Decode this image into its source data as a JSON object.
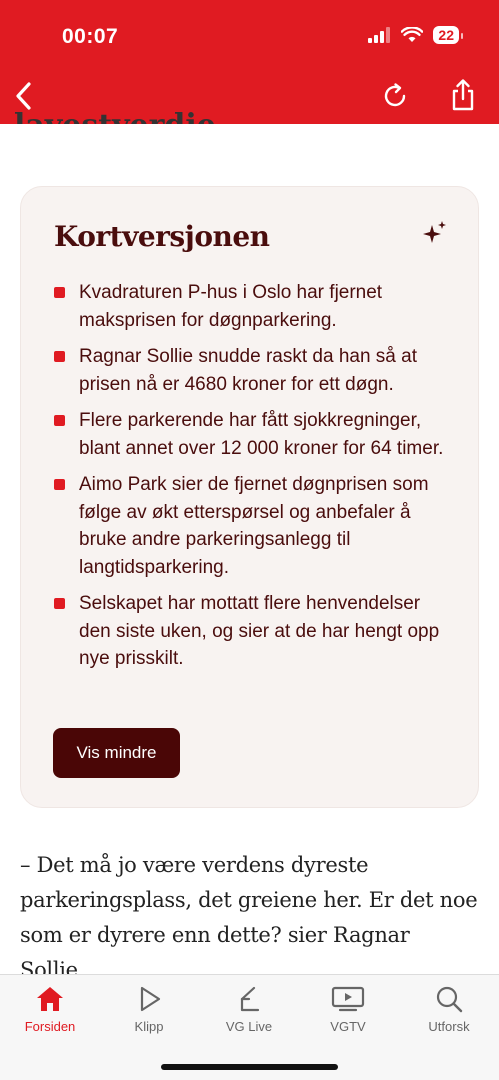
{
  "status_bar": {
    "time": "00:07",
    "battery": "22"
  },
  "nav": {
    "back_icon": "chevron-left-icon",
    "reload_icon": "reload-icon",
    "share_icon": "share-icon"
  },
  "article": {
    "cut_heading": "lavestverdie"
  },
  "summary": {
    "title": "Kortversjonen",
    "sparkle_icon": "sparkle-icon",
    "bullets": [
      "Kvadraturen P-hus i Oslo har fjernet maksprisen for døgnparkering.",
      "Ragnar Sollie snudde raskt da han så at prisen nå er 4680 kroner for ett døgn.",
      "Flere parkerende har fått sjokkregninger, blant annet over 12 000 kroner for 64 timer.",
      "Aimo Park sier de fjernet døgnprisen som følge av økt etterspørsel og anbefaler å bruke andre parkeringsanlegg til langtidsparkering.",
      "Selskapet har mottatt flere henvendelser den siste uken, og sier at de har hengt opp nye prisskilt."
    ],
    "button_label": "Vis mindre"
  },
  "quote": "– Det må jo være verdens dyreste parkeringsplass, det greiene her. Er det noe som er dyrere enn dette? sier Ragnar Sollie.",
  "tabs": [
    {
      "label": "Forsiden",
      "icon": "home-icon",
      "active": true
    },
    {
      "label": "Klipp",
      "icon": "play-icon",
      "active": false
    },
    {
      "label": "VG Live",
      "icon": "vg-live-icon",
      "active": false
    },
    {
      "label": "VGTV",
      "icon": "tv-icon",
      "active": false
    },
    {
      "label": "Utforsk",
      "icon": "search-icon",
      "active": false
    }
  ],
  "colors": {
    "brand_red": "#e01b22",
    "dark_red": "#4a0606",
    "card_bg": "#f8f3f1"
  }
}
